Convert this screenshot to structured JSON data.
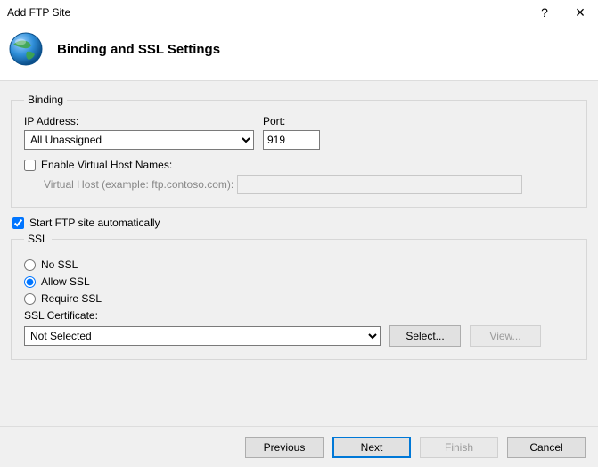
{
  "window": {
    "title": "Add FTP Site",
    "help": "?",
    "close": "×"
  },
  "header": {
    "heading": "Binding and SSL Settings"
  },
  "binding": {
    "legend": "Binding",
    "ip_label": "IP Address:",
    "ip_value": "All Unassigned",
    "port_label": "Port:",
    "port_value": "919",
    "enable_vhost_label": "Enable Virtual Host Names:",
    "enable_vhost_checked": false,
    "vhost_label": "Virtual Host (example: ftp.contoso.com):",
    "vhost_value": ""
  },
  "autostart": {
    "label": "Start FTP site automatically",
    "checked": true
  },
  "ssl": {
    "legend": "SSL",
    "no_ssl": "No SSL",
    "allow_ssl": "Allow SSL",
    "require_ssl": "Require SSL",
    "selected": "allow",
    "cert_label": "SSL Certificate:",
    "cert_value": "Not Selected",
    "select_btn": "Select...",
    "view_btn": "View..."
  },
  "footer": {
    "previous": "Previous",
    "next": "Next",
    "finish": "Finish",
    "cancel": "Cancel"
  }
}
